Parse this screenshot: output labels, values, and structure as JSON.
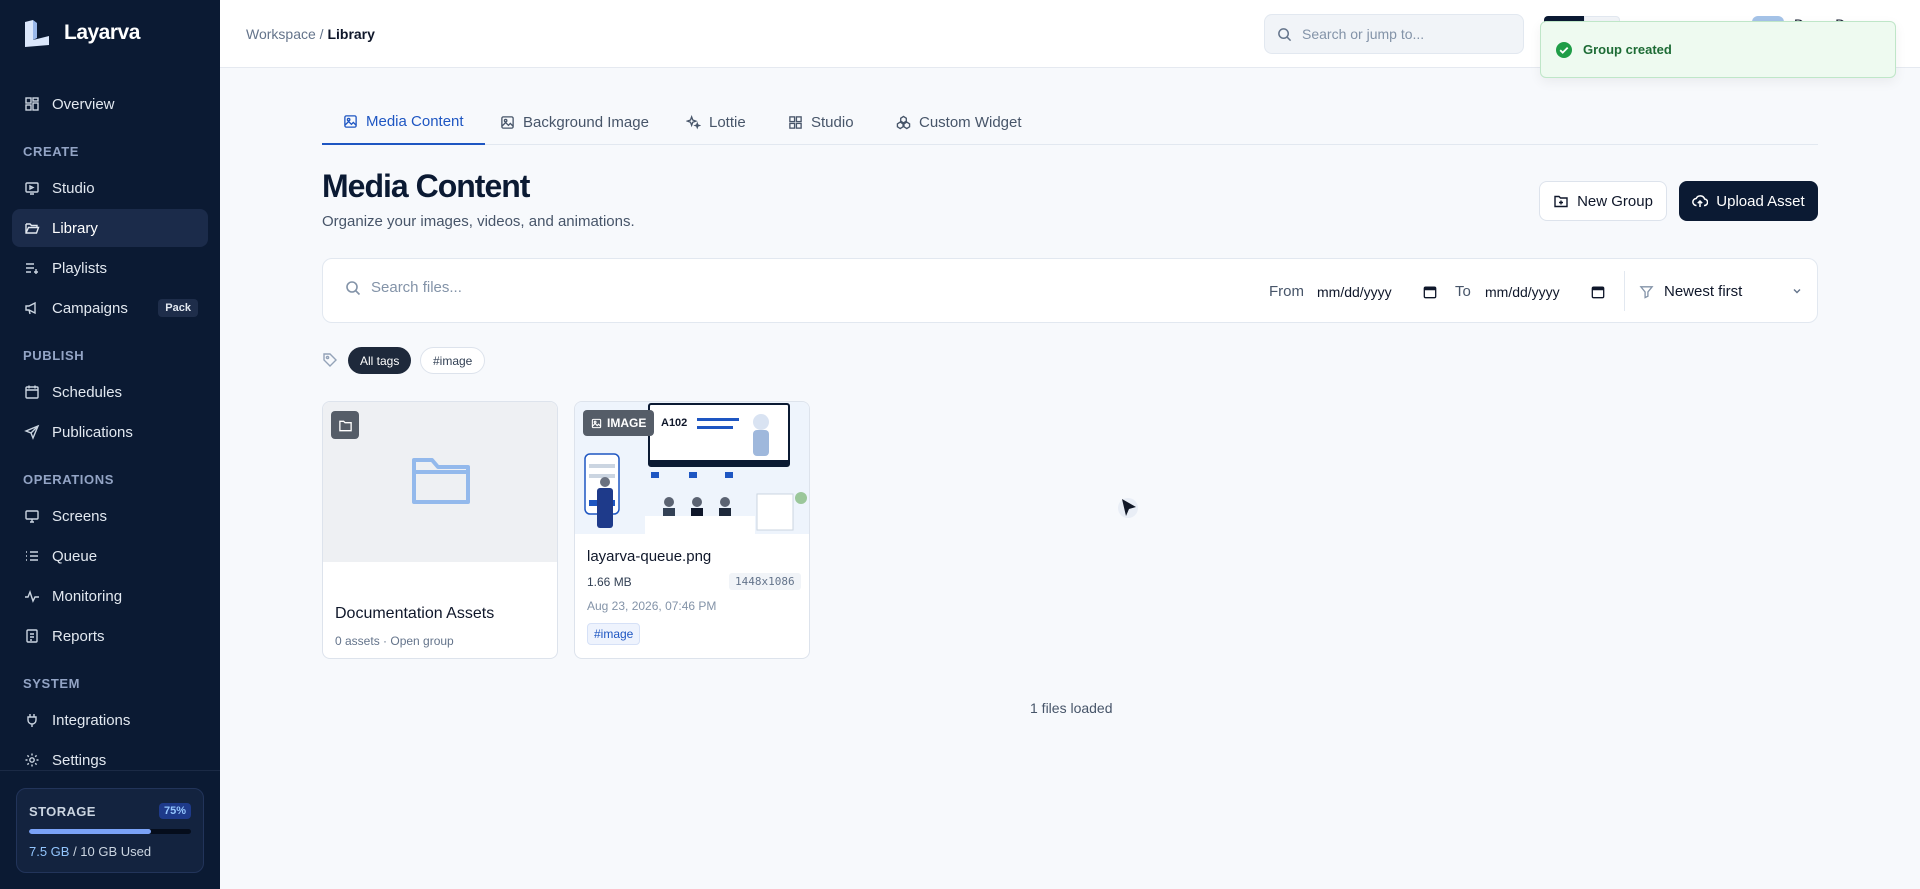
{
  "app": {
    "name": "Layarva"
  },
  "sidebar": {
    "overview": "Overview",
    "sections": {
      "create": "CREATE",
      "publish": "PUBLISH",
      "operations": "OPERATIONS",
      "system": "SYSTEM"
    },
    "items": {
      "studio": "Studio",
      "library": "Library",
      "playlists": "Playlists",
      "campaigns": "Campaigns",
      "campaigns_badge": "Pack",
      "schedules": "Schedules",
      "publications": "Publications",
      "screens": "Screens",
      "queue": "Queue",
      "monitoring": "Monitoring",
      "reports": "Reports",
      "integrations": "Integrations",
      "settings": "Settings"
    },
    "storage": {
      "label": "STORAGE",
      "percent": "75%",
      "fill_fraction": 0.75,
      "used": "7.5 GB",
      "rest": " / 10 GB Used"
    }
  },
  "header": {
    "breadcrumb_root": "Workspace",
    "breadcrumb_sep": " / ",
    "breadcrumb_current": "Library",
    "search_placeholder": "Search or jump to...",
    "user_name": "Demo Desc"
  },
  "toast": {
    "message": "Group created"
  },
  "tabs": [
    "Media Content",
    "Background Image",
    "Lottie",
    "Studio",
    "Custom Widget"
  ],
  "page": {
    "title": "Media Content",
    "subtitle": "Organize your images, videos, and animations.",
    "new_group": "New Group",
    "upload_asset": "Upload Asset"
  },
  "filters": {
    "search_placeholder": "Search files...",
    "from_label": "From",
    "from_value": "mm/dd/yyyy",
    "to_label": "To",
    "to_value": "mm/dd/yyyy",
    "sort": "Newest first"
  },
  "tags": {
    "all": "All tags",
    "image": "#image"
  },
  "cards": {
    "folder": {
      "title": "Documentation Assets",
      "meta": "0 assets · Open group"
    },
    "image": {
      "badge": "IMAGE",
      "title": "layarva-queue.png",
      "size": "1.66 MB",
      "dims": "1448x1086",
      "date": "Aug 23, 2026, 07:46 PM",
      "tag": "#image",
      "thumb_text": "A102"
    }
  },
  "footer": {
    "files_loaded": "1 files loaded"
  },
  "colors": {
    "sidebar": "#0b1a33",
    "accent": "#1e56c2",
    "toast_bg": "#eefaf0",
    "success": "#1f9d47"
  }
}
